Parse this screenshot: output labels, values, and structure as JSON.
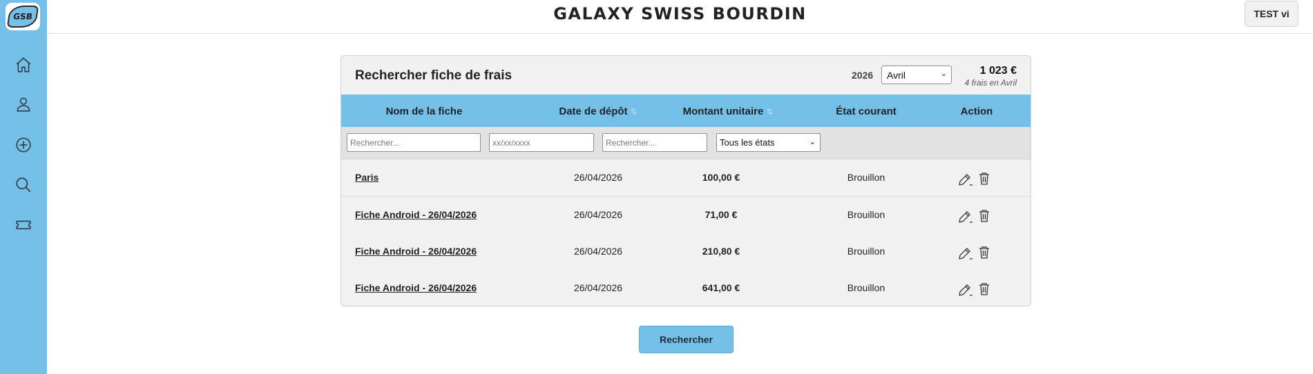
{
  "app": {
    "logo_text": "GSB",
    "title": "GALAXY SWISS BOURDIN",
    "user_label": "TEST vi"
  },
  "sidebar": {
    "items": [
      {
        "icon": "home-icon"
      },
      {
        "icon": "user-icon"
      },
      {
        "icon": "add-circle-icon"
      },
      {
        "icon": "search-icon"
      },
      {
        "icon": "ticket-icon"
      }
    ]
  },
  "search_panel": {
    "title": "Rechercher fiche de frais",
    "year": "2026",
    "month_selected": "Avril",
    "total": "1 023 €",
    "total_caption": "4 frais en Avril",
    "columns": {
      "name": "Nom de la fiche",
      "date": "Date de dépôt",
      "amount": "Montant unitaire",
      "state": "État courant",
      "action": "Action"
    },
    "filters": {
      "name_placeholder": "Rechercher...",
      "date_placeholder": "xx/xx/xxxx",
      "amount_placeholder": "Rechercher...",
      "state_selected": "Tous les états"
    },
    "rows": [
      {
        "name": "Paris",
        "date": "26/04/2026",
        "amount": "100,00 €",
        "state": "Brouillon"
      },
      {
        "name": "Fiche Android - 26/04/2026",
        "date": "26/04/2026",
        "amount": "71,00 €",
        "state": "Brouillon"
      },
      {
        "name": "Fiche Android - 26/04/2026",
        "date": "26/04/2026",
        "amount": "210,80 €",
        "state": "Brouillon"
      },
      {
        "name": "Fiche Android - 26/04/2026",
        "date": "26/04/2026",
        "amount": "641,00 €",
        "state": "Brouillon"
      }
    ],
    "submit_label": "Rechercher"
  },
  "colors": {
    "accent": "#74c0e8",
    "panel": "#f1f1f1",
    "filter_bar": "#e2e2e2"
  }
}
